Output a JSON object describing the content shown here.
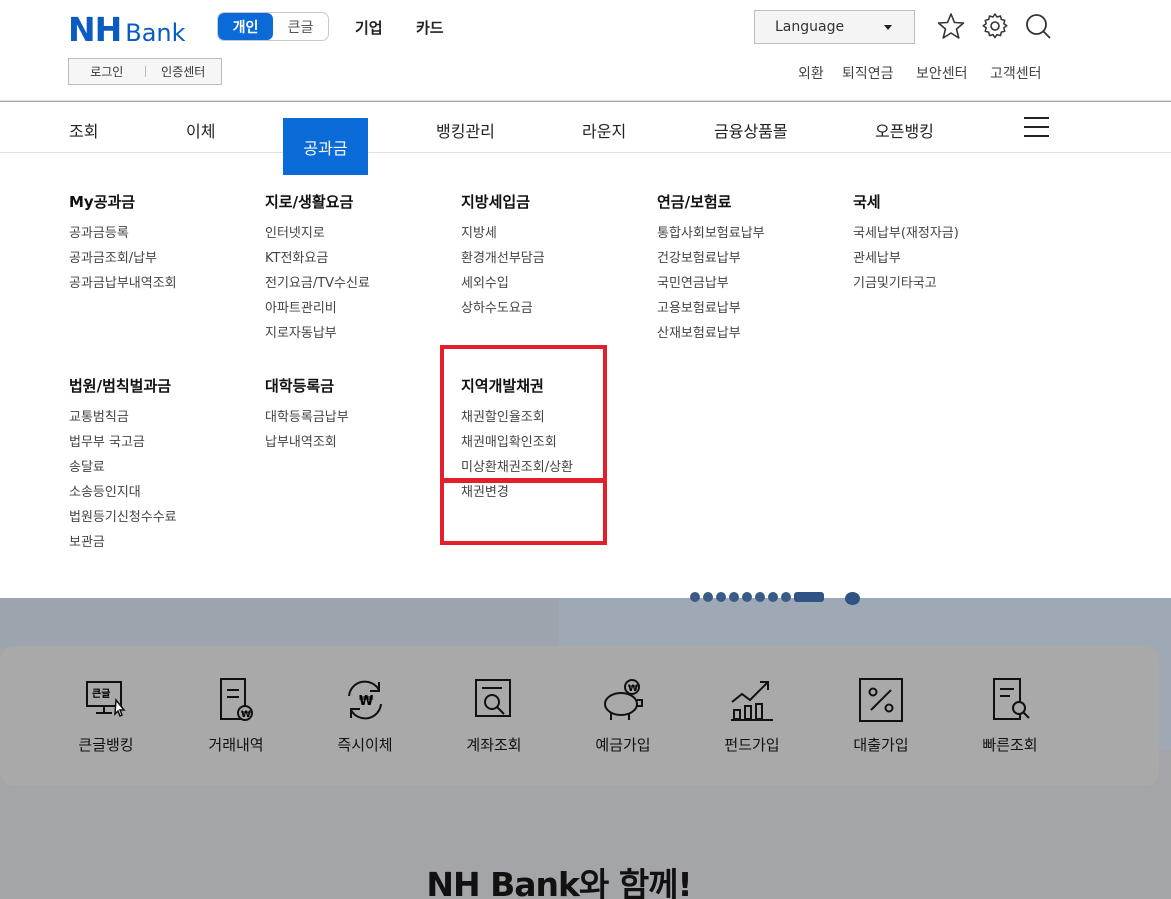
{
  "header": {
    "logo_nh": "NH",
    "logo_bank": "Bank",
    "mode_personal": "개인",
    "mode_large": "큰글",
    "menu_corporate": "기업",
    "menu_card": "카드",
    "login": "로그인",
    "cert_center": "인증센터",
    "language": "Language",
    "utils": [
      "외환",
      "퇴직연금",
      "보안센터",
      "고객센터"
    ]
  },
  "gnb": {
    "items": [
      "조회",
      "이체",
      "공과금",
      "뱅킹관리",
      "라운지",
      "금융상품몰",
      "오픈뱅킹"
    ],
    "active": "공과금"
  },
  "megamenu": {
    "row1": [
      {
        "title": "My공과금",
        "links": [
          "공과금등록",
          "공과금조회/납부",
          "공과금납부내역조회"
        ]
      },
      {
        "title": "지로/생활요금",
        "links": [
          "인터넷지로",
          "KT전화요금",
          "전기요금/TV수신료",
          "아파트관리비",
          "지로자동납부"
        ]
      },
      {
        "title": "지방세입금",
        "links": [
          "지방세",
          "환경개선부담금",
          "세외수입",
          "상하수도요금"
        ]
      },
      {
        "title": "연금/보험료",
        "links": [
          "통합사회보험료납부",
          "건강보험료납부",
          "국민연금납부",
          "고용보험료납부",
          "산재보험료납부"
        ]
      },
      {
        "title": "국세",
        "links": [
          "국세납부(재정자금)",
          "관세납부",
          "기금및기타국고"
        ]
      }
    ],
    "row2": [
      {
        "title": "법원/범칙벌과금",
        "links": [
          "교통범칙금",
          "법무부 국고금",
          "송달료",
          "소송등인지대",
          "법원등기신청수수료",
          "보관금"
        ]
      },
      {
        "title": "대학등록금",
        "links": [
          "대학등록금납부",
          "납부내역조회"
        ]
      },
      {
        "title": "지역개발채권",
        "links": [
          "채권할인율조회",
          "채권매입확인조회",
          "미상환채권조회/상환",
          "채권변경"
        ]
      }
    ]
  },
  "quick_menu": [
    "큰글뱅킹",
    "거래내역",
    "즉시이체",
    "계좌조회",
    "예금가입",
    "펀드가입",
    "대출가입",
    "빠른조회"
  ],
  "quick_icon_text": {
    "large_text": "큰글",
    "won": "₩"
  },
  "slogan": "NH Bank와 함께!",
  "colors": {
    "brand_blue": "#0a6bd8",
    "highlight_red": "#e21f2a"
  }
}
